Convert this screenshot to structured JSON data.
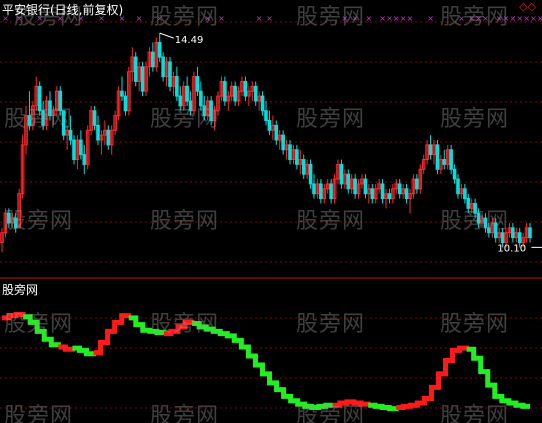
{
  "title": "平安银行(日线,前复权)",
  "indicator_label": "股旁网",
  "corner_symbol": "◇◇",
  "watermark": "股旁网",
  "colors": {
    "up": "#ff2a2a",
    "down": "#00e0e0",
    "line_up": "#ff1a1a",
    "line_down": "#22ee22",
    "marker": "#cc33cc",
    "grid": "#7a0a0a",
    "divider": "#c41414"
  },
  "chart_data": [
    {
      "type": "candlestick",
      "title": "平安银行(日线,前复权)",
      "ylim": [
        9.8,
        14.8
      ],
      "annotations": [
        {
          "text": "14.49",
          "value": 14.49,
          "bar_index": 46
        },
        {
          "text": "10.10",
          "value": 10.1,
          "bar_index": 162
        }
      ],
      "marker_bars": [
        1,
        5,
        11,
        17,
        23,
        29,
        35,
        40,
        46,
        60,
        64,
        75,
        78,
        100,
        103,
        107,
        111,
        113,
        115,
        117,
        119,
        125,
        134,
        137,
        139,
        141,
        145,
        147,
        149,
        151,
        153,
        155,
        157,
        159,
        163
      ],
      "candles": [
        [
          10.2,
          10.5,
          10.0,
          10.4
        ],
        [
          10.4,
          10.9,
          10.3,
          10.8
        ],
        [
          10.8,
          10.9,
          10.5,
          10.6
        ],
        [
          10.6,
          10.8,
          10.5,
          10.7
        ],
        [
          10.7,
          10.8,
          10.4,
          10.5
        ],
        [
          10.5,
          11.3,
          10.5,
          11.2
        ],
        [
          11.2,
          12.4,
          11.1,
          12.2
        ],
        [
          12.2,
          13.0,
          12.0,
          12.8
        ],
        [
          12.8,
          13.3,
          12.5,
          12.6
        ],
        [
          12.6,
          13.1,
          12.5,
          13.0
        ],
        [
          13.0,
          13.6,
          12.9,
          13.4
        ],
        [
          13.4,
          13.5,
          12.8,
          12.9
        ],
        [
          12.9,
          13.1,
          12.5,
          12.6
        ],
        [
          12.6,
          13.2,
          12.5,
          13.1
        ],
        [
          13.1,
          13.3,
          12.7,
          12.8
        ],
        [
          12.8,
          13.0,
          12.6,
          12.9
        ],
        [
          12.9,
          13.4,
          12.8,
          13.3
        ],
        [
          13.3,
          13.4,
          12.8,
          12.9
        ],
        [
          12.9,
          12.9,
          12.3,
          12.4
        ],
        [
          12.4,
          12.6,
          12.1,
          12.5
        ],
        [
          12.5,
          12.8,
          12.2,
          12.3
        ],
        [
          12.3,
          12.4,
          11.8,
          11.9
        ],
        [
          11.9,
          12.4,
          11.7,
          12.3
        ],
        [
          12.3,
          12.5,
          11.9,
          12.0
        ],
        [
          12.0,
          12.2,
          11.6,
          11.8
        ],
        [
          11.8,
          12.6,
          11.7,
          12.5
        ],
        [
          12.5,
          13.0,
          12.4,
          12.9
        ],
        [
          12.9,
          13.0,
          12.5,
          12.6
        ],
        [
          12.6,
          12.8,
          12.2,
          12.3
        ],
        [
          12.3,
          12.5,
          12.0,
          12.4
        ],
        [
          12.4,
          12.7,
          12.2,
          12.5
        ],
        [
          12.5,
          12.6,
          12.1,
          12.2
        ],
        [
          12.2,
          12.6,
          12.0,
          12.5
        ],
        [
          12.5,
          12.9,
          12.4,
          12.8
        ],
        [
          12.8,
          13.4,
          12.7,
          13.3
        ],
        [
          13.3,
          13.6,
          13.1,
          13.2
        ],
        [
          13.2,
          13.3,
          12.8,
          12.9
        ],
        [
          12.9,
          13.8,
          12.8,
          13.7
        ],
        [
          13.7,
          14.2,
          13.5,
          14.0
        ],
        [
          14.0,
          14.1,
          13.4,
          13.5
        ],
        [
          13.5,
          13.9,
          13.3,
          13.8
        ],
        [
          13.8,
          13.9,
          13.2,
          13.3
        ],
        [
          13.3,
          13.9,
          13.2,
          13.8
        ],
        [
          13.8,
          14.2,
          13.6,
          14.1
        ],
        [
          14.1,
          14.3,
          13.7,
          13.8
        ],
        [
          13.8,
          14.4,
          13.7,
          14.3
        ],
        [
          14.3,
          14.49,
          13.9,
          14.0
        ],
        [
          14.0,
          14.1,
          13.5,
          13.6
        ],
        [
          13.6,
          14.0,
          13.4,
          13.9
        ],
        [
          13.9,
          14.0,
          13.3,
          13.4
        ],
        [
          13.4,
          13.7,
          13.2,
          13.6
        ],
        [
          13.6,
          13.8,
          13.1,
          13.2
        ],
        [
          13.2,
          13.4,
          12.9,
          13.0
        ],
        [
          13.0,
          13.5,
          12.9,
          13.4
        ],
        [
          13.4,
          13.6,
          13.0,
          13.1
        ],
        [
          13.1,
          13.3,
          12.8,
          12.9
        ],
        [
          12.9,
          13.7,
          12.8,
          13.6
        ],
        [
          13.6,
          13.8,
          13.2,
          13.3
        ],
        [
          13.3,
          13.5,
          12.9,
          13.0
        ],
        [
          13.0,
          13.2,
          12.7,
          12.8
        ],
        [
          12.8,
          13.2,
          12.7,
          13.1
        ],
        [
          13.1,
          13.2,
          12.6,
          12.7
        ],
        [
          12.7,
          13.0,
          12.5,
          12.9
        ],
        [
          12.9,
          13.3,
          12.8,
          13.2
        ],
        [
          13.2,
          13.6,
          13.1,
          13.5
        ],
        [
          13.5,
          13.6,
          13.0,
          13.1
        ],
        [
          13.1,
          13.3,
          12.9,
          13.2
        ],
        [
          13.2,
          13.5,
          13.1,
          13.4
        ],
        [
          13.4,
          13.5,
          13.0,
          13.1
        ],
        [
          13.1,
          13.4,
          13.0,
          13.3
        ],
        [
          13.3,
          13.6,
          13.2,
          13.5
        ],
        [
          13.5,
          13.6,
          13.1,
          13.2
        ],
        [
          13.2,
          13.4,
          13.0,
          13.3
        ],
        [
          13.3,
          13.5,
          13.1,
          13.4
        ],
        [
          13.4,
          13.5,
          13.0,
          13.1
        ],
        [
          13.1,
          13.3,
          12.9,
          13.2
        ],
        [
          13.2,
          13.3,
          12.8,
          12.9
        ],
        [
          12.9,
          13.1,
          12.6,
          12.7
        ],
        [
          12.7,
          12.9,
          12.4,
          12.5
        ],
        [
          12.5,
          12.8,
          12.3,
          12.6
        ],
        [
          12.6,
          12.7,
          12.2,
          12.3
        ],
        [
          12.3,
          12.5,
          12.1,
          12.4
        ],
        [
          12.4,
          12.5,
          12.0,
          12.1
        ],
        [
          12.1,
          12.3,
          11.9,
          12.2
        ],
        [
          12.2,
          12.3,
          11.8,
          11.9
        ],
        [
          11.9,
          12.2,
          11.8,
          12.1
        ],
        [
          12.1,
          12.2,
          11.7,
          11.8
        ],
        [
          11.8,
          12.1,
          11.6,
          11.9
        ],
        [
          11.9,
          12.0,
          11.5,
          11.6
        ],
        [
          11.6,
          11.9,
          11.5,
          11.8
        ],
        [
          11.8,
          11.9,
          11.3,
          11.4
        ],
        [
          11.4,
          11.6,
          11.1,
          11.2
        ],
        [
          11.2,
          11.5,
          11.1,
          11.4
        ],
        [
          11.4,
          11.5,
          11.0,
          11.1
        ],
        [
          11.1,
          11.4,
          11.0,
          11.3
        ],
        [
          11.3,
          11.5,
          11.2,
          11.4
        ],
        [
          11.4,
          11.5,
          11.0,
          11.1
        ],
        [
          11.1,
          11.6,
          11.0,
          11.5
        ],
        [
          11.5,
          11.9,
          11.4,
          11.8
        ],
        [
          11.8,
          11.9,
          11.3,
          11.4
        ],
        [
          11.4,
          11.7,
          11.3,
          11.6
        ],
        [
          11.6,
          11.7,
          11.2,
          11.3
        ],
        [
          11.3,
          11.6,
          11.2,
          11.5
        ],
        [
          11.5,
          11.6,
          11.1,
          11.2
        ],
        [
          11.2,
          11.5,
          11.1,
          11.4
        ],
        [
          11.4,
          11.6,
          11.3,
          11.5
        ],
        [
          11.5,
          11.6,
          11.1,
          11.2
        ],
        [
          11.2,
          11.4,
          11.0,
          11.3
        ],
        [
          11.3,
          11.4,
          11.0,
          11.1
        ],
        [
          11.1,
          11.4,
          11.0,
          11.3
        ],
        [
          11.3,
          11.5,
          11.2,
          11.4
        ],
        [
          11.4,
          11.5,
          11.0,
          11.1
        ],
        [
          11.1,
          11.3,
          10.9,
          11.2
        ],
        [
          11.2,
          11.3,
          11.0,
          11.1
        ],
        [
          11.1,
          11.4,
          11.0,
          11.3
        ],
        [
          11.3,
          11.5,
          11.2,
          11.4
        ],
        [
          11.4,
          11.5,
          11.1,
          11.2
        ],
        [
          11.2,
          11.4,
          11.1,
          11.3
        ],
        [
          11.3,
          11.4,
          11.0,
          11.1
        ],
        [
          11.1,
          11.3,
          10.8,
          11.2
        ],
        [
          11.2,
          11.6,
          11.1,
          11.5
        ],
        [
          11.5,
          11.6,
          11.2,
          11.3
        ],
        [
          11.3,
          11.8,
          11.2,
          11.7
        ],
        [
          11.7,
          12.0,
          11.6,
          11.9
        ],
        [
          11.9,
          12.3,
          11.8,
          12.2
        ],
        [
          12.2,
          12.4,
          11.9,
          12.0
        ],
        [
          12.0,
          12.3,
          11.8,
          12.2
        ],
        [
          12.2,
          12.3,
          11.6,
          11.7
        ],
        [
          11.7,
          12.0,
          11.6,
          11.9
        ],
        [
          11.9,
          12.1,
          11.7,
          11.8
        ],
        [
          11.8,
          12.2,
          11.7,
          12.1
        ],
        [
          12.1,
          12.2,
          11.6,
          11.7
        ],
        [
          11.7,
          11.8,
          11.4,
          11.5
        ],
        [
          11.5,
          11.6,
          11.1,
          11.2
        ],
        [
          11.2,
          11.4,
          11.1,
          11.3
        ],
        [
          11.3,
          11.4,
          11.0,
          11.1
        ],
        [
          11.1,
          11.2,
          10.8,
          10.9
        ],
        [
          10.9,
          11.1,
          10.8,
          11.0
        ],
        [
          11.0,
          11.1,
          10.7,
          10.8
        ],
        [
          10.8,
          10.9,
          10.5,
          10.6
        ],
        [
          10.6,
          10.8,
          10.5,
          10.7
        ],
        [
          10.7,
          10.8,
          10.4,
          10.5
        ],
        [
          10.5,
          10.6,
          10.3,
          10.4
        ],
        [
          10.4,
          10.7,
          10.3,
          10.6
        ],
        [
          10.6,
          10.7,
          10.2,
          10.3
        ],
        [
          10.3,
          10.5,
          10.2,
          10.4
        ],
        [
          10.4,
          10.5,
          10.1,
          10.2
        ],
        [
          10.2,
          10.5,
          10.1,
          10.4
        ],
        [
          10.4,
          10.6,
          10.3,
          10.5
        ],
        [
          10.5,
          10.6,
          10.2,
          10.3
        ],
        [
          10.3,
          10.5,
          10.2,
          10.4
        ],
        [
          10.4,
          10.5,
          10.1,
          10.2
        ],
        [
          10.2,
          10.4,
          10.1,
          10.3
        ],
        [
          10.3,
          10.6,
          10.2,
          10.5
        ],
        [
          10.5,
          10.6,
          10.2,
          10.3
        ]
      ]
    },
    {
      "type": "line",
      "title": "股旁网",
      "ylim": [
        0,
        100
      ],
      "segments": [
        {
          "trend": "up",
          "values": [
            84,
            86,
            87,
            85
          ]
        },
        {
          "trend": "down",
          "values": [
            85,
            80,
            72,
            65,
            60,
            58
          ]
        },
        {
          "trend": "up",
          "values": [
            58,
            56,
            57
          ]
        },
        {
          "trend": "down",
          "values": [
            57,
            55,
            52,
            53
          ]
        },
        {
          "trend": "up",
          "values": [
            53,
            62,
            72,
            80,
            86,
            84
          ]
        },
        {
          "trend": "down",
          "values": [
            84,
            78,
            73,
            72,
            71,
            70
          ]
        },
        {
          "trend": "up",
          "values": [
            70,
            72,
            76,
            80,
            79
          ]
        },
        {
          "trend": "down",
          "values": [
            79,
            76,
            74,
            72,
            70,
            68,
            64,
            58,
            50,
            42,
            34,
            26,
            20,
            14,
            10,
            7,
            5,
            4,
            5,
            6,
            6
          ]
        },
        {
          "trend": "up",
          "values": [
            6,
            8,
            9,
            8,
            7,
            6
          ]
        },
        {
          "trend": "down",
          "values": [
            6,
            5,
            4,
            3,
            4
          ]
        },
        {
          "trend": "up",
          "values": [
            4,
            5,
            6,
            8,
            12,
            22,
            34,
            46,
            55,
            57,
            56
          ]
        },
        {
          "trend": "down",
          "values": [
            56,
            48,
            36,
            24,
            14,
            10,
            8,
            6,
            5,
            5
          ]
        }
      ]
    }
  ]
}
